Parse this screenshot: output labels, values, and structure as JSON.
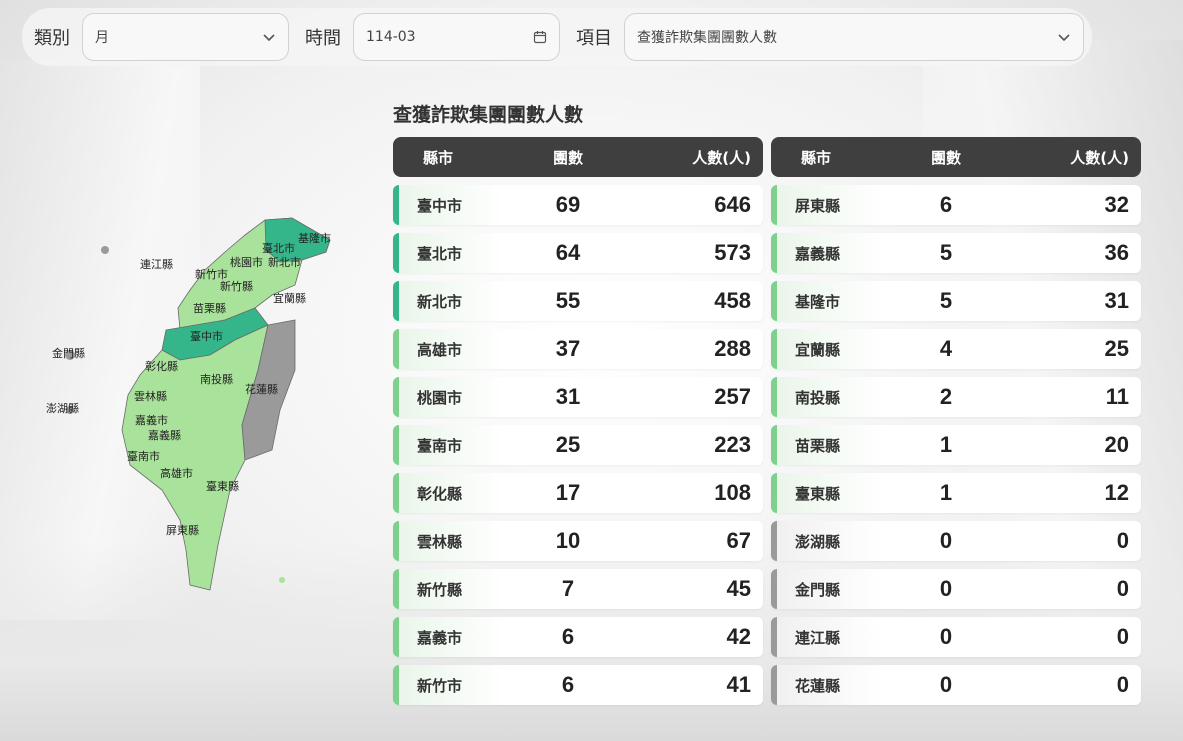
{
  "filters": {
    "category_label": "類別",
    "category_value": "月",
    "time_label": "時間",
    "time_value": "114-03",
    "item_label": "項目",
    "item_value": "查獲詐欺集團團數人數"
  },
  "section_title": "查獲詐欺集團團數人數",
  "table_headers": {
    "county": "縣市",
    "groups": "團數",
    "people": "人數(人)"
  },
  "colors": {
    "dark_green": "#35b58a",
    "mid_green": "#7fd08d",
    "light_green": "#a9e29b",
    "gray": "#9a9a9a",
    "header_bg": "#3f3f3f"
  },
  "left_rows": [
    {
      "county": "臺中市",
      "groups": "69",
      "people": "646",
      "level": "dark"
    },
    {
      "county": "臺北市",
      "groups": "64",
      "people": "573",
      "level": "dark"
    },
    {
      "county": "新北市",
      "groups": "55",
      "people": "458",
      "level": "dark"
    },
    {
      "county": "高雄市",
      "groups": "37",
      "people": "288",
      "level": "light"
    },
    {
      "county": "桃園市",
      "groups": "31",
      "people": "257",
      "level": "light"
    },
    {
      "county": "臺南市",
      "groups": "25",
      "people": "223",
      "level": "light"
    },
    {
      "county": "彰化縣",
      "groups": "17",
      "people": "108",
      "level": "light"
    },
    {
      "county": "雲林縣",
      "groups": "10",
      "people": "67",
      "level": "light"
    },
    {
      "county": "新竹縣",
      "groups": "7",
      "people": "45",
      "level": "light"
    },
    {
      "county": "嘉義市",
      "groups": "6",
      "people": "42",
      "level": "light"
    },
    {
      "county": "新竹市",
      "groups": "6",
      "people": "41",
      "level": "light"
    }
  ],
  "right_rows": [
    {
      "county": "屏東縣",
      "groups": "6",
      "people": "32",
      "level": "light"
    },
    {
      "county": "嘉義縣",
      "groups": "5",
      "people": "36",
      "level": "light"
    },
    {
      "county": "基隆市",
      "groups": "5",
      "people": "31",
      "level": "light"
    },
    {
      "county": "宜蘭縣",
      "groups": "4",
      "people": "25",
      "level": "light"
    },
    {
      "county": "南投縣",
      "groups": "2",
      "people": "11",
      "level": "light"
    },
    {
      "county": "苗栗縣",
      "groups": "1",
      "people": "20",
      "level": "light"
    },
    {
      "county": "臺東縣",
      "groups": "1",
      "people": "12",
      "level": "light"
    },
    {
      "county": "澎湖縣",
      "groups": "0",
      "people": "0",
      "level": "gray"
    },
    {
      "county": "金門縣",
      "groups": "0",
      "people": "0",
      "level": "gray"
    },
    {
      "county": "連江縣",
      "groups": "0",
      "people": "0",
      "level": "gray"
    },
    {
      "county": "花蓮縣",
      "groups": "0",
      "people": "0",
      "level": "gray"
    }
  ],
  "map_labels": {
    "keelung": "基隆市",
    "taipei": "臺北市",
    "taoyuan": "桃園市",
    "new_taipei": "新北市",
    "lienchiang": "連江縣",
    "hsinchu_city": "新竹市",
    "hsinchu_county": "新竹縣",
    "yilan": "宜蘭縣",
    "miaoli": "苗栗縣",
    "taichung": "臺中市",
    "kinmen": "金門縣",
    "changhua": "彰化縣",
    "nantou": "南投縣",
    "hualien": "花蓮縣",
    "yunlin": "雲林縣",
    "penghu": "澎湖縣",
    "chiayi_city": "嘉義市",
    "chiayi_county": "嘉義縣",
    "tainan": "臺南市",
    "kaohsiung": "高雄市",
    "taitung": "臺東縣",
    "pingtung": "屏東縣"
  }
}
